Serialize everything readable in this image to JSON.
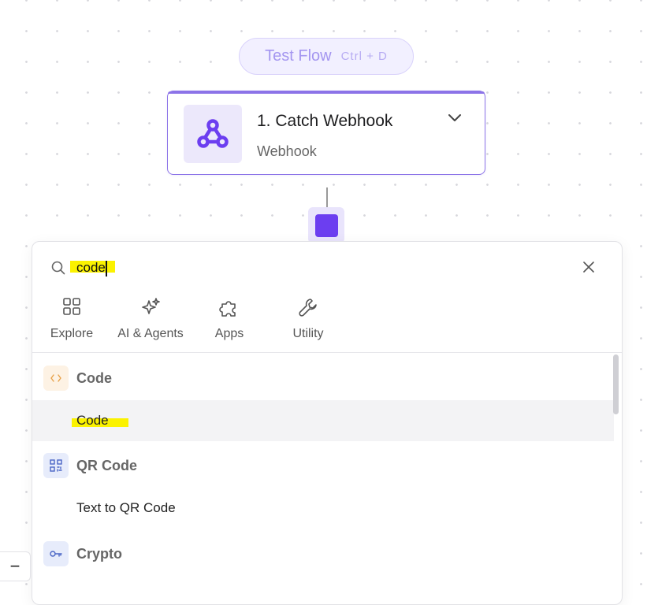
{
  "test_flow": {
    "label": "Test Flow",
    "shortcut": "Ctrl + D"
  },
  "step": {
    "title": "1. Catch Webhook",
    "subtitle": "Webhook",
    "icon": "webhook-icon"
  },
  "search": {
    "value": "code",
    "icon": "search-icon"
  },
  "categories": [
    {
      "label": "Explore",
      "icon": "grid-icon"
    },
    {
      "label": "AI & Agents",
      "icon": "sparkle-icon"
    },
    {
      "label": "Apps",
      "icon": "puzzle-icon"
    },
    {
      "label": "Utility",
      "icon": "wrench-icon"
    }
  ],
  "results": [
    {
      "group": "Code",
      "icon": "code-icon",
      "items": [
        "Code"
      ]
    },
    {
      "group": "QR Code",
      "icon": "qr-code-icon",
      "items": [
        "Text to QR Code"
      ]
    },
    {
      "group": "Crypto",
      "icon": "key-icon",
      "items": []
    }
  ],
  "zoom_out": {
    "label": "−"
  },
  "colors": {
    "accent": "#6c3ef0",
    "highlight": "#fbf200",
    "node_border": "#8c73e8"
  }
}
